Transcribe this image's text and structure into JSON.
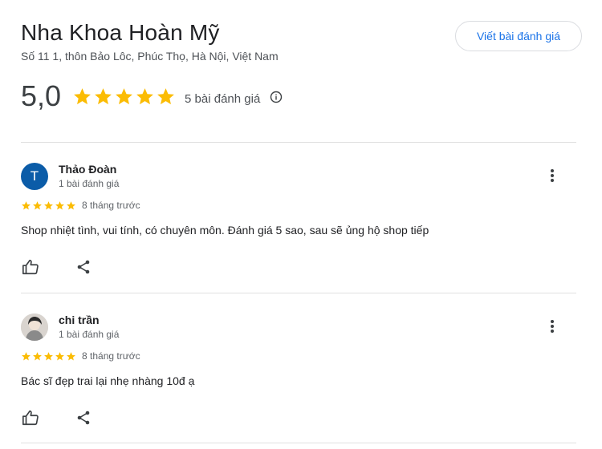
{
  "business": {
    "name": "Nha Khoa Hoàn Mỹ",
    "address": "Số 11 1, thôn Bảo Lôc, Phúc Thọ, Hà Nội, Việt Nam",
    "write_review_label": "Viết bài đánh giá",
    "rating": "5,0",
    "stars": 5,
    "review_count_label": "5 bài đánh giá"
  },
  "colors": {
    "star": "#fbbc04",
    "link": "#1a73e8",
    "avatar_bg": "#0b5ca8"
  },
  "icons": {
    "info": "info-icon",
    "more": "more-vert-icon",
    "like": "thumb-up-icon",
    "share": "share-icon"
  },
  "reviews": [
    {
      "name": "Thảo Đoàn",
      "avatar_letter": "T",
      "meta": "1 bài đánh giá",
      "stars": 5,
      "date": "8 tháng trước",
      "text": "Shop nhiệt tình, vui tính, có chuyên môn. Đánh giá 5 sao, sau sẽ ủng hộ shop tiếp"
    },
    {
      "name": "chi trần",
      "avatar_letter": "",
      "meta": "1 bài đánh giá",
      "stars": 5,
      "date": "8 tháng trước",
      "text": "Bác sĩ đẹp trai lại nhẹ nhàng 10đ ạ"
    }
  ]
}
